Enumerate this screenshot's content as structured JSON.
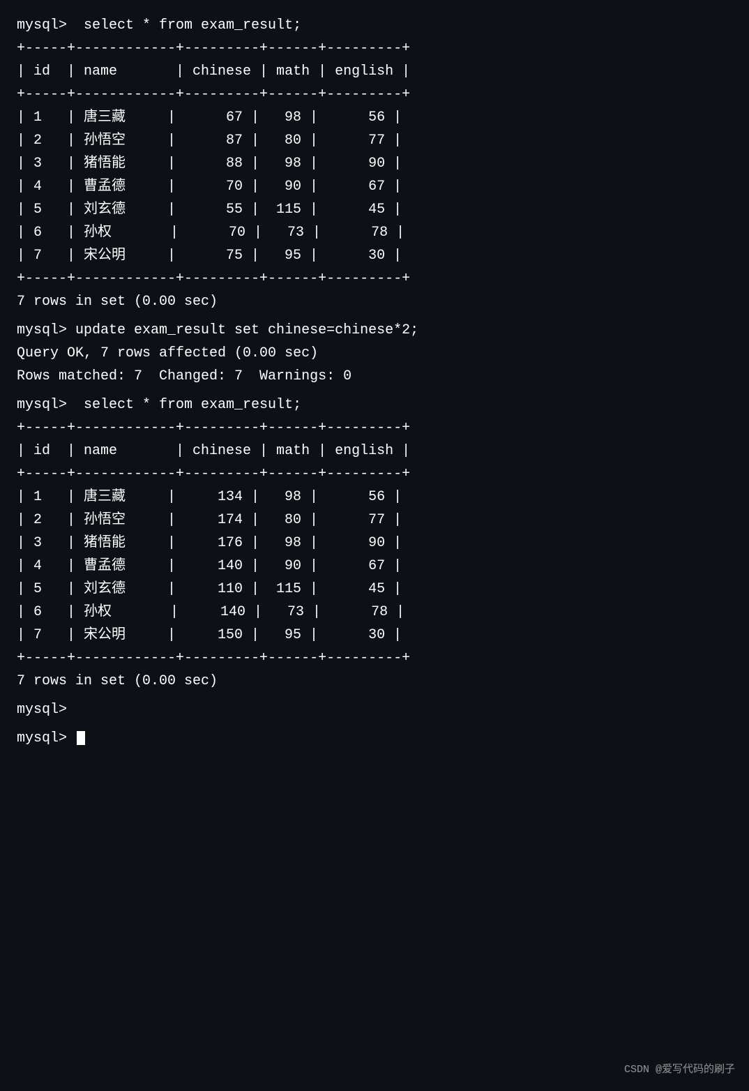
{
  "terminal": {
    "sections": [
      {
        "id": "query1",
        "lines": [
          "mysql>  select * from exam_result;",
          "+-----+------------+---------+------+---------+",
          "| id  | name       | chinese | math | english |",
          "+-----+------------+---------+------+---------+",
          "| 1   | 唐三藏     |      67 |   98 |      56 |",
          "| 2   | 孙悟空     |      87 |   80 |      77 |",
          "| 3   | 猪悟能     |      88 |   98 |      90 |",
          "| 4   | 曹孟德     |      70 |   90 |      67 |",
          "| 5   | 刘玄德     |      55 |  115 |      45 |",
          "| 6   | 孙权       |      70 |   73 |      78 |",
          "| 7   | 宋公明     |      75 |   95 |      30 |",
          "+-----+------------+---------+------+---------+",
          "7 rows in set (0.00 sec)"
        ]
      },
      {
        "id": "update",
        "lines": [
          "mysql> update exam_result set chinese=chinese*2;",
          "Query OK, 7 rows affected (0.00 sec)",
          "Rows matched: 7  Changed: 7  Warnings: 0"
        ]
      },
      {
        "id": "query2",
        "lines": [
          "mysql>  select * from exam_result;",
          "+-----+------------+---------+------+---------+",
          "| id  | name       | chinese | math | english |",
          "+-----+------------+---------+------+---------+",
          "| 1   | 唐三藏     |     134 |   98 |      56 |",
          "| 2   | 孙悟空     |     174 |   80 |      77 |",
          "| 3   | 猪悟能     |     176 |   98 |      90 |",
          "| 4   | 曹孟德     |     140 |   90 |      67 |",
          "| 5   | 刘玄德     |     110 |  115 |      45 |",
          "| 6   | 孙权       |     140 |   73 |      78 |",
          "| 7   | 宋公明     |     150 |   95 |      30 |",
          "+-----+------------+---------+------+---------+",
          "7 rows in set (0.00 sec)"
        ]
      },
      {
        "id": "prompt_end",
        "lines": [
          "mysql> "
        ]
      }
    ],
    "watermark": "CSDN @爱写代码的刷子"
  }
}
